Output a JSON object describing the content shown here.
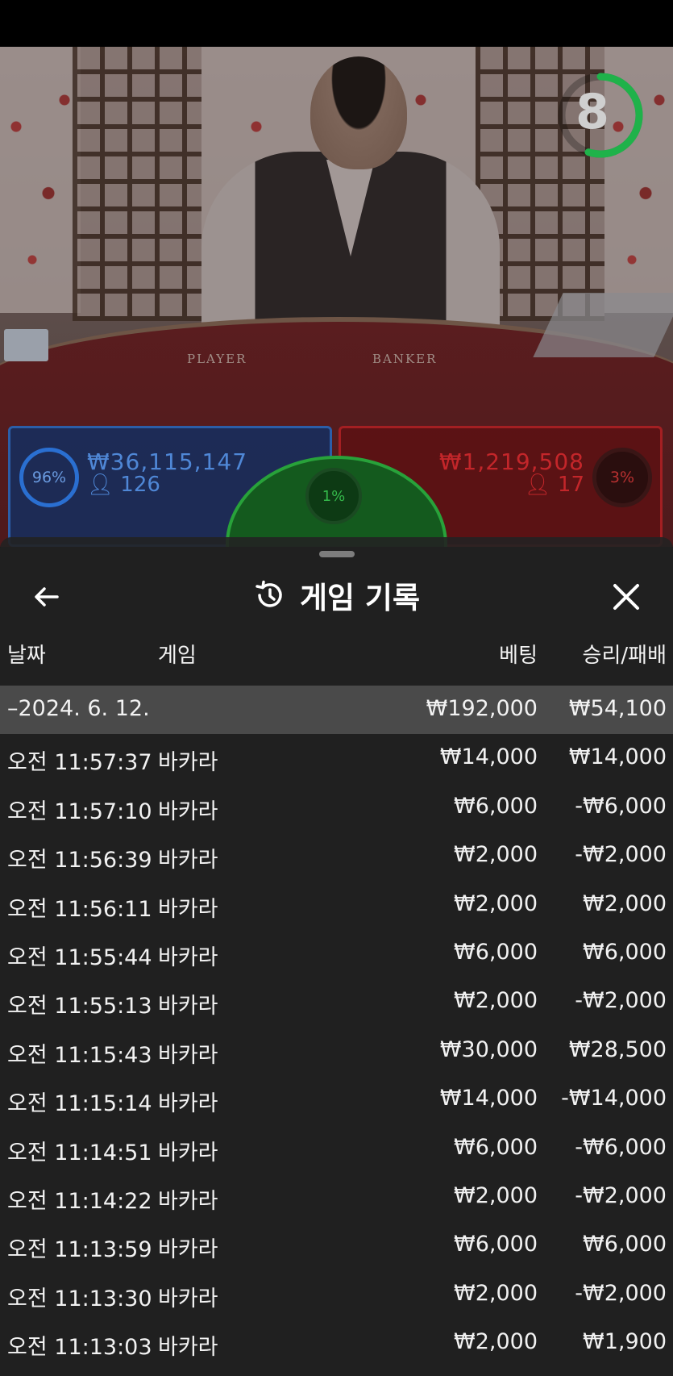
{
  "stream": {
    "countdown": "8",
    "countdown_progress": 0.55,
    "table_labels": {
      "player": "PLAYER",
      "banker": "BANKER"
    }
  },
  "bets": {
    "player": {
      "percent": "96%",
      "amount": "₩36,115,147",
      "players": "126"
    },
    "banker": {
      "percent": "3%",
      "amount": "₩1,219,508",
      "players": "17"
    },
    "tie": {
      "percent": "1%"
    }
  },
  "history": {
    "title": "게임 기록",
    "columns": {
      "date": "날짜",
      "game": "게임",
      "bet": "베팅",
      "win_loss": "승리/패배"
    },
    "date_group": {
      "date": "–2024. 6. 12.",
      "bet": "₩192,000",
      "win_loss": "₩54,100"
    },
    "rows": [
      {
        "time": "오전 11:57:37",
        "game": "바카라",
        "bet": "₩14,000",
        "win_loss": "₩14,000"
      },
      {
        "time": "오전 11:57:10",
        "game": "바카라",
        "bet": "₩6,000",
        "win_loss": "-₩6,000"
      },
      {
        "time": "오전 11:56:39",
        "game": "바카라",
        "bet": "₩2,000",
        "win_loss": "-₩2,000"
      },
      {
        "time": "오전 11:56:11",
        "game": "바카라",
        "bet": "₩2,000",
        "win_loss": "₩2,000"
      },
      {
        "time": "오전 11:55:44",
        "game": "바카라",
        "bet": "₩6,000",
        "win_loss": "₩6,000"
      },
      {
        "time": "오전 11:55:13",
        "game": "바카라",
        "bet": "₩2,000",
        "win_loss": "-₩2,000"
      },
      {
        "time": "오전 11:15:43",
        "game": "바카라",
        "bet": "₩30,000",
        "win_loss": "₩28,500"
      },
      {
        "time": "오전 11:15:14",
        "game": "바카라",
        "bet": "₩14,000",
        "win_loss": "-₩14,000"
      },
      {
        "time": "오전 11:14:51",
        "game": "바카라",
        "bet": "₩6,000",
        "win_loss": "-₩6,000"
      },
      {
        "time": "오전 11:14:22",
        "game": "바카라",
        "bet": "₩2,000",
        "win_loss": "-₩2,000"
      },
      {
        "time": "오전 11:13:59",
        "game": "바카라",
        "bet": "₩6,000",
        "win_loss": "₩6,000"
      },
      {
        "time": "오전 11:13:30",
        "game": "바카라",
        "bet": "₩2,000",
        "win_loss": "-₩2,000"
      },
      {
        "time": "오전 11:13:03",
        "game": "바카라",
        "bet": "₩2,000",
        "win_loss": "₩1,900"
      }
    ]
  },
  "icons": {
    "back": "arrow-left-icon",
    "history": "history-clock-icon",
    "close": "close-x-icon",
    "person": "person-icon"
  },
  "colors": {
    "player": "#2b5ea8",
    "banker": "#a31f22",
    "tie": "#28a23a",
    "timer": "#1fb24a",
    "sheet": "#222222",
    "date_row": "#4a4a4a"
  }
}
